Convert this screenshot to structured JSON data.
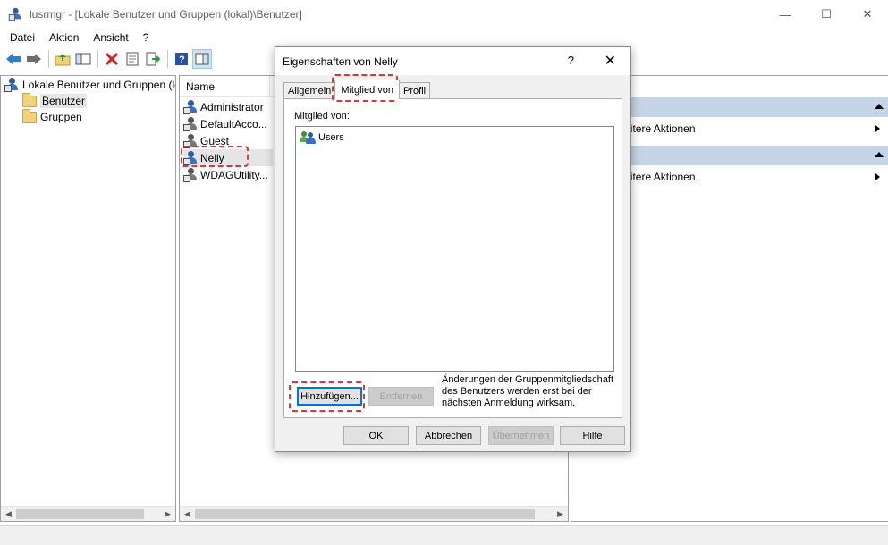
{
  "window": {
    "title": "lusrmgr - [Lokale Benutzer und Gruppen (lokal)\\Benutzer]",
    "controls": [
      "—",
      "☐",
      "✕"
    ]
  },
  "menu": [
    "Datei",
    "Aktion",
    "Ansicht",
    "?"
  ],
  "tree": {
    "root": "Lokale Benutzer und Gruppen (lokal)",
    "items": [
      "Benutzer",
      "Gruppen"
    ]
  },
  "list": {
    "column": "Name",
    "rows": [
      "Administrator",
      "DefaultAcco...",
      "Guest",
      "Nelly",
      "WDAGUtility..."
    ]
  },
  "actions": {
    "items": [
      "Weitere Aktionen",
      "Weitere Aktionen"
    ]
  },
  "dialog": {
    "title": "Eigenschaften von Nelly",
    "help": "?",
    "close": "✕",
    "tabs": [
      "Allgemein",
      "Mitglied von",
      "Profil"
    ],
    "member_label": "Mitglied von:",
    "members": [
      "Users"
    ],
    "add_button": "Hinzufügen...",
    "remove_button": "Entfernen",
    "info": "Änderungen der Gruppenmitgliedschaft des Benutzers werden erst bei der nächsten Anmeldung wirksam.",
    "ok": "OK",
    "cancel": "Abbrechen",
    "apply": "Übernehmen",
    "help_button": "Hilfe"
  },
  "colors": {
    "highlight": "#e0343c",
    "action_header": "#c5d4e6",
    "default_button_border": "#0078d7"
  }
}
